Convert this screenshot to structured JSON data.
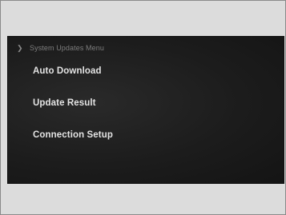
{
  "menu": {
    "header": "System Updates Menu",
    "header_icon": "chevron-right-icon",
    "items": [
      {
        "label": "Auto Download"
      },
      {
        "label": "Update Result"
      },
      {
        "label": "Connection Setup"
      }
    ]
  },
  "colors": {
    "screen_bg": "#1c1c1c",
    "item_text": "#e3e3e3",
    "header_text": "#7d7d7d"
  }
}
